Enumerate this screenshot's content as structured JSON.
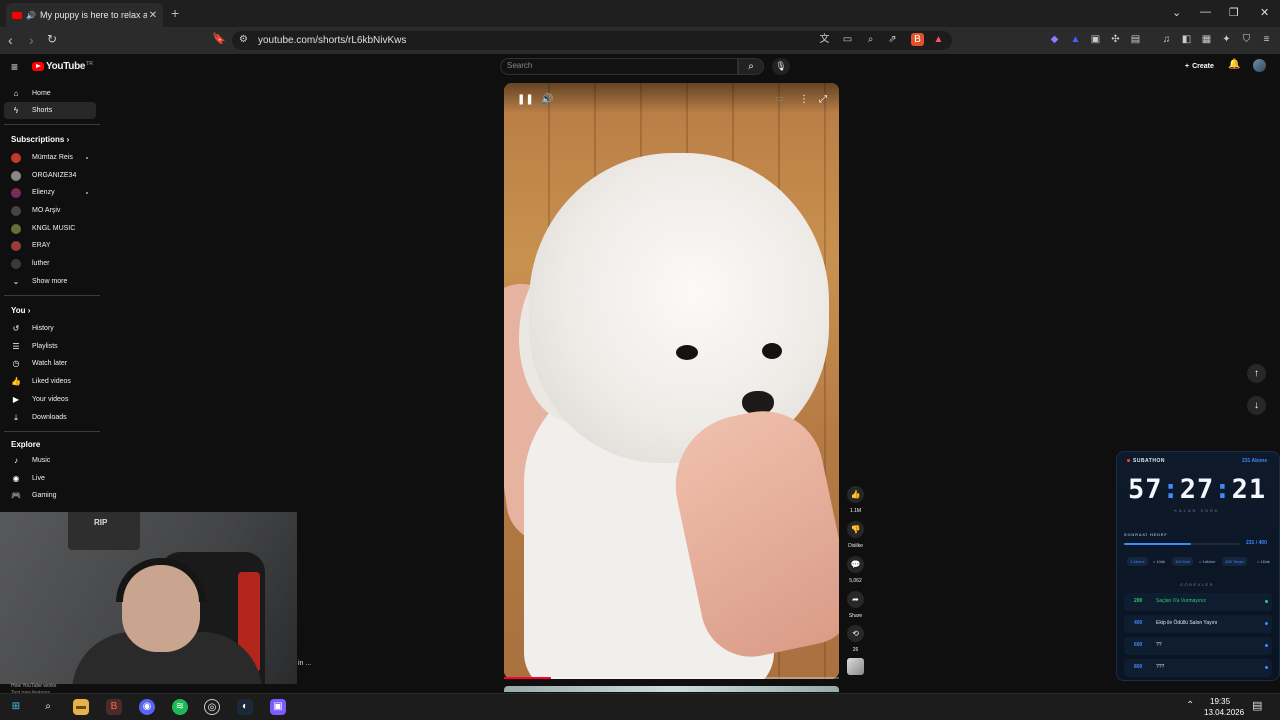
{
  "browser": {
    "tab_title": "My puppy is here to relax and",
    "url": "youtube.com/shorts/rL6kbNivKws"
  },
  "youtube": {
    "logo_text": "YouTube",
    "logo_region": "TR",
    "search_placeholder": "Search",
    "create_label": "Create"
  },
  "sidebar": {
    "main": [
      {
        "label": "Home",
        "icon": "home-icon"
      },
      {
        "label": "Shorts",
        "icon": "shorts-icon"
      }
    ],
    "subscriptions_heading": "Subscriptions",
    "subscriptions": [
      {
        "label": "Mümtaz Reis",
        "color": "#c0392b",
        "dot": true
      },
      {
        "label": "ORGANIZE34",
        "color": "#888888",
        "dot": false
      },
      {
        "label": "Elienzy",
        "color": "#7a2a5a",
        "dot": true
      },
      {
        "label": "MO Arşiv",
        "color": "#444444",
        "dot": false
      },
      {
        "label": "KNGL MUSIC",
        "color": "#6a6a3a",
        "dot": false
      },
      {
        "label": "ERAY",
        "color": "#9b3b3b",
        "dot": false
      },
      {
        "label": "luther",
        "color": "#3b3b3b",
        "dot": false
      }
    ],
    "show_more": "Show more",
    "you_heading": "You",
    "you_items": [
      {
        "label": "History"
      },
      {
        "label": "Playlists"
      },
      {
        "label": "Watch later"
      },
      {
        "label": "Liked videos"
      },
      {
        "label": "Your videos"
      },
      {
        "label": "Downloads"
      }
    ],
    "explore_heading": "Explore",
    "explore_items": [
      {
        "label": "Music"
      },
      {
        "label": "Live"
      },
      {
        "label": "Gaming"
      }
    ],
    "how_line1": "How YouTube works",
    "how_line2": "Test new features"
  },
  "webcam": {
    "shelf_label": "RIP",
    "bg_text": "in ..."
  },
  "short": {
    "progress": 0.14,
    "likes": "1.1M",
    "dislike_label": "Dislike",
    "comments": "5,062",
    "share_label": "Share",
    "remix_count": "26"
  },
  "subathon": {
    "badge": "SUBATHON",
    "subs": "231 Abone",
    "timer_h": "57",
    "timer_m": "27",
    "timer_s": "21",
    "remaining_label": "KALAN SÜRE",
    "next_goal_label": "SONRAKİ HEDEF",
    "next_goal_value": "231 / 400",
    "next_goal_progress": 0.58,
    "chips": [
      {
        "text": "1 Abone",
        "accent": true
      },
      {
        "text": "= 10dk",
        "accent": false
      },
      {
        "text": "100 Kick",
        "accent": true
      },
      {
        "text": "= 1dk/km",
        "accent": false
      },
      {
        "text": "10K Tanjer",
        "accent": true
      },
      {
        "text": "= 1Dak",
        "accent": false
      }
    ],
    "goals_label": "GÖREVLER",
    "goals": [
      {
        "n": "200",
        "text": "Saçları 0'a Vurmayınız",
        "color": "#2ecc71",
        "done": true
      },
      {
        "n": "400",
        "text": "Ekip ile Ödüllü Salon Yayını",
        "color": "#3d8bff",
        "done": false
      },
      {
        "n": "600",
        "text": "??",
        "color": "#3d8bff",
        "done": false
      },
      {
        "n": "800",
        "text": "???",
        "color": "#3d8bff",
        "done": false
      }
    ]
  },
  "taskbar": {
    "time": "19:35",
    "date": "13.04.2026"
  }
}
